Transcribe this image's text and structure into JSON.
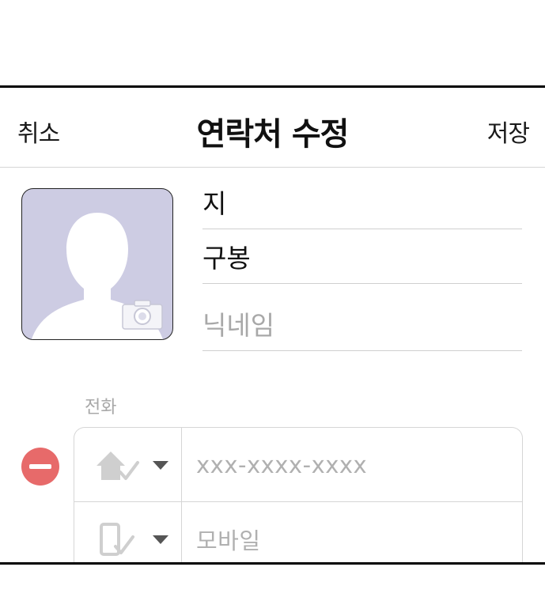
{
  "header": {
    "cancel_label": "취소",
    "title": "연락처 수정",
    "save_label": "저장"
  },
  "name_fields": [
    {
      "value": "지"
    },
    {
      "value": "구봉"
    },
    {
      "placeholder": "닉네임"
    }
  ],
  "phone_section": {
    "label": "전화",
    "rows": [
      {
        "type_icon": "home-phone-icon",
        "placeholder": "xxx-xxxx-xxxx"
      },
      {
        "type_icon": "mobile-phone-icon",
        "placeholder": "모바일"
      }
    ]
  },
  "colors": {
    "avatar_bg": "#cdcce3",
    "remove_red": "#e76a6a"
  }
}
